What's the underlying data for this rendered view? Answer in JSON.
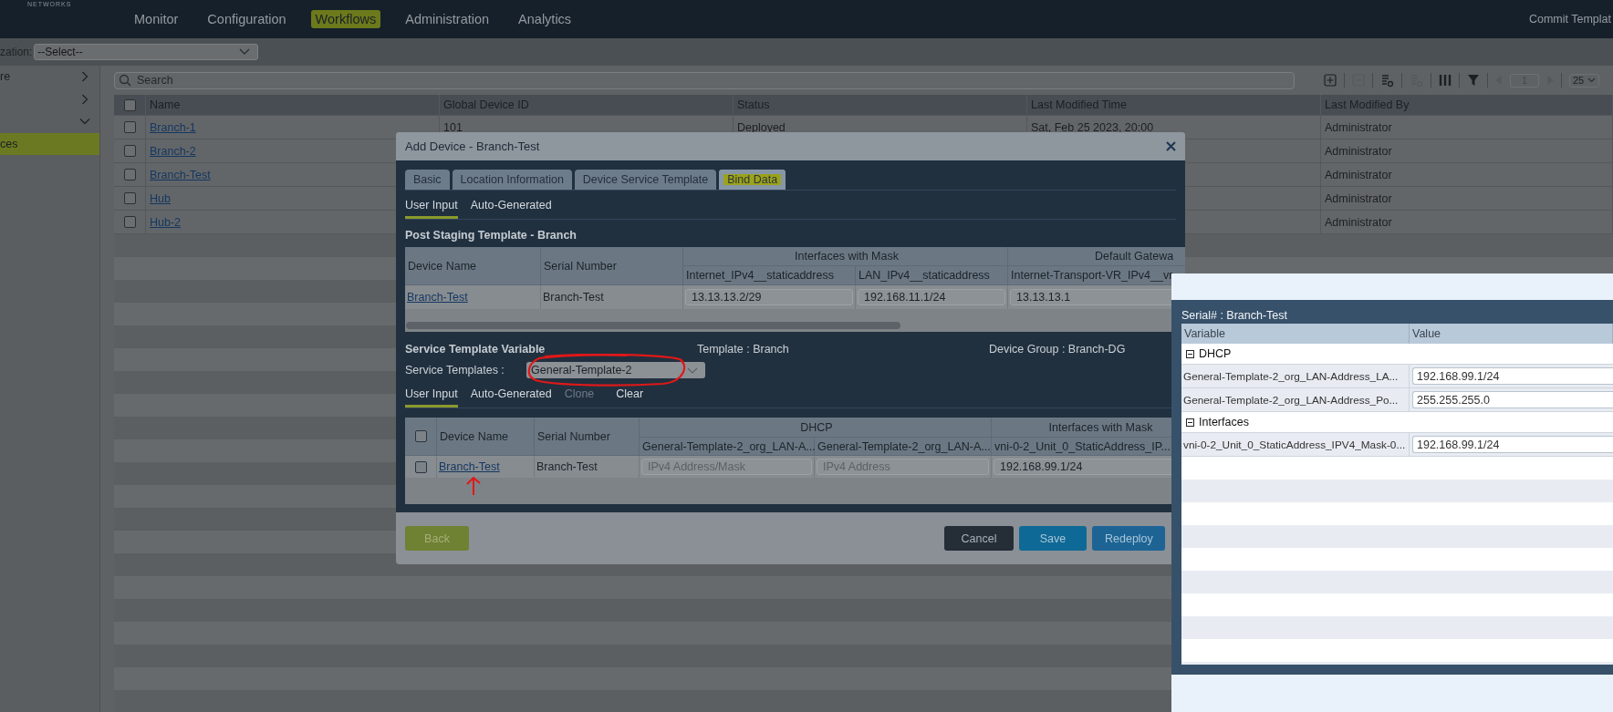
{
  "logo": {
    "subtitle": "NETWORKS"
  },
  "nav": [
    {
      "label": "Monitor",
      "selected": false
    },
    {
      "label": "Configuration",
      "selected": false
    },
    {
      "label": "Workflows",
      "selected": true
    },
    {
      "label": "Administration",
      "selected": false
    },
    {
      "label": "Analytics",
      "selected": false
    }
  ],
  "header_action": "Commit Templat",
  "organization": {
    "label": "zation:",
    "value": "--Select--"
  },
  "sidebar": [
    {
      "label": "re",
      "kind": "group",
      "expanded": false,
      "selected": false
    },
    {
      "kind": "group",
      "expanded": false,
      "selected": false
    },
    {
      "kind": "group",
      "expanded": true,
      "selected": false
    },
    {
      "label": "ces",
      "kind": "item",
      "selected": true
    }
  ],
  "search": {
    "placeholder": "Search"
  },
  "pager": {
    "page": "1",
    "page_size": "25"
  },
  "devices": {
    "all_checked": false,
    "columns": [
      "Name",
      "Global Device ID",
      "Status",
      "Last Modified Time",
      "Last Modified By"
    ],
    "rows": [
      {
        "checked": false,
        "name": "Branch-1",
        "id": "101",
        "status": "Deployed",
        "time": "Sat, Feb 25 2023, 20:00",
        "by": "Administrator"
      },
      {
        "checked": false,
        "name": "Branch-2",
        "by": "Administrator"
      },
      {
        "checked": false,
        "name": "Branch-Test",
        "by": "Administrator"
      },
      {
        "checked": false,
        "name": "Hub",
        "by": "Administrator"
      },
      {
        "checked": false,
        "name": "Hub-2",
        "by": "Administrator"
      }
    ]
  },
  "modal": {
    "title": "Add Device - Branch-Test",
    "tabs": [
      {
        "label": "Basic",
        "selected": false
      },
      {
        "label": "Location Information",
        "selected": false
      },
      {
        "label": "Device Service Template",
        "selected": false
      },
      {
        "label": "Bind Data",
        "selected": true
      }
    ],
    "subtabs": [
      {
        "label": "User Input",
        "selected": true
      },
      {
        "label": "Auto-Generated",
        "selected": false
      }
    ],
    "post_staging": {
      "title": "Post Staging Template - Branch",
      "columns": [
        "Device Name",
        "Serial Number"
      ],
      "groups": [
        {
          "label": "Interfaces with Mask",
          "columns": [
            "Internet_IPv4__staticaddress",
            "LAN_IPv4__staticaddress"
          ]
        },
        {
          "label": "Default Gatewa",
          "columns": [
            "Internet-Transport-VR_IPv4__vr"
          ]
        }
      ],
      "rows": [
        {
          "device": "Branch-Test",
          "serial": "Branch-Test",
          "values": [
            "13.13.13.2/29",
            "192.168.11.1/24",
            "13.13.13.1"
          ]
        }
      ]
    },
    "service": {
      "title": "Service Template Variable",
      "template": "Template : Branch",
      "device_group": "Device Group : Branch-DG",
      "select_label": "Service Templates :",
      "select_value": "General-Template-2",
      "subtabs": [
        {
          "label": "User Input",
          "selected": true,
          "disabled": false
        },
        {
          "label": "Auto-Generated",
          "selected": false,
          "disabled": false
        },
        {
          "label": "Clone",
          "selected": false,
          "disabled": true
        },
        {
          "label": "Clear",
          "selected": false,
          "disabled": false
        }
      ],
      "table": {
        "all_checked": false,
        "columns": [
          "Device Name",
          "Serial Number"
        ],
        "groups": [
          {
            "label": "DHCP",
            "columns": [
              "General-Template-2_org_LAN-A...",
              "General-Template-2_org_LAN-A..."
            ]
          },
          {
            "label": "Interfaces with Mask",
            "columns": [
              "vni-0-2_Unit_0_StaticAddress_IP..."
            ]
          }
        ],
        "rows": [
          {
            "checked": false,
            "device": "Branch-Test",
            "serial": "Branch-Test",
            "fields": [
              {
                "placeholder": "IPv4 Address/Mask"
              },
              {
                "placeholder": "IPv4 Address"
              },
              {
                "value": "192.168.99.1/24"
              }
            ]
          }
        ]
      }
    },
    "buttons": [
      {
        "label": "Back",
        "kind": "back"
      },
      {
        "label": "Cancel",
        "kind": "cancel"
      },
      {
        "label": "Save",
        "kind": "save"
      },
      {
        "label": "Redeploy",
        "kind": "redeploy"
      }
    ]
  },
  "serial_panel": {
    "title": "Serial# : Branch-Test",
    "columns": [
      "Variable",
      "Value"
    ],
    "groups": [
      {
        "label": "DHCP",
        "expanded": true,
        "children": [
          {
            "variable": "General-Template-2_org_LAN-Address_LA...",
            "value": "192.168.99.1/24"
          },
          {
            "variable": "General-Template-2_org_LAN-Address_Po...",
            "value": "255.255.255.0"
          }
        ]
      },
      {
        "label": "Interfaces",
        "expanded": true,
        "children": [
          {
            "variable": "vni-0-2_Unit_0_StaticAddress_IPV4_Mask-0...",
            "value": "192.168.99.1/24"
          }
        ]
      }
    ]
  }
}
